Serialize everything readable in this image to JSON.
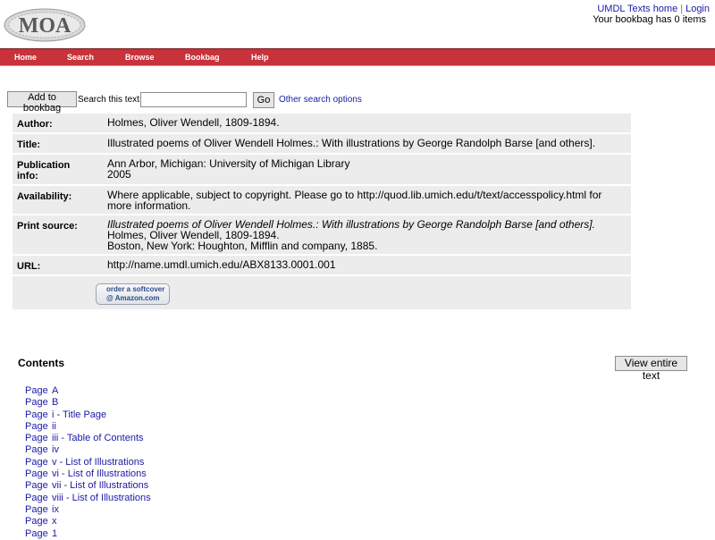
{
  "header": {
    "logo_text": "MOA",
    "links": [
      "UMDL Texts home",
      "Login"
    ],
    "bookbag_status": "Your bookbag has 0 items"
  },
  "nav": [
    "Home",
    "Search",
    "Browse",
    "Bookbag",
    "Help"
  ],
  "search": {
    "add_bookbag_label": "Add to bookbag",
    "label": "Search this text:",
    "value": "",
    "go_label": "Go",
    "other_link": "Other search options"
  },
  "metadata": {
    "author_label": "Author:",
    "author": "Holmes, Oliver Wendell, 1809-1894.",
    "title_label": "Title:",
    "title": "Illustrated poems of Oliver Wendell Holmes.: With illustrations by George Randolph Barse [and others].",
    "pub_label": "Publication info:",
    "pub_line1": "Ann Arbor, Michigan: University of Michigan Library",
    "pub_line2": "2005",
    "avail_label": "Availability:",
    "availability": "Where applicable, subject to copyright. Please go to http://quod.lib.umich.edu/t/text/accesspolicy.html for more information.",
    "print_label": "Print source:",
    "print_title": "Illustrated poems of Oliver Wendell Holmes.: With illustrations by George Randolph Barse [and others].",
    "print_author": "Holmes, Oliver Wendell, 1809-1894.",
    "print_pub": "Boston, New York: Houghton, Mifflin and company, 1885.",
    "url_label": "URL:",
    "url": "http://name.umdl.umich.edu/ABX8133.0001.001",
    "amazon_line1": "order a softcover",
    "amazon_line2": "@ Amazon.com"
  },
  "contents": {
    "title": "Contents",
    "view_entire": "View entire text",
    "page_prefix": "Page",
    "pages": [
      "A",
      "B",
      "i - Title Page",
      "ii",
      "iii - Table of Contents",
      "iv",
      "v - List of Illustrations",
      "vi - List of Illustrations",
      "vii - List of Illustrations",
      "viii - List of Illustrations",
      "ix",
      "x",
      "1"
    ]
  },
  "colors": {
    "navbar": "#c8323a",
    "link": "#1a1aa6",
    "row_bg": "#ececec"
  }
}
